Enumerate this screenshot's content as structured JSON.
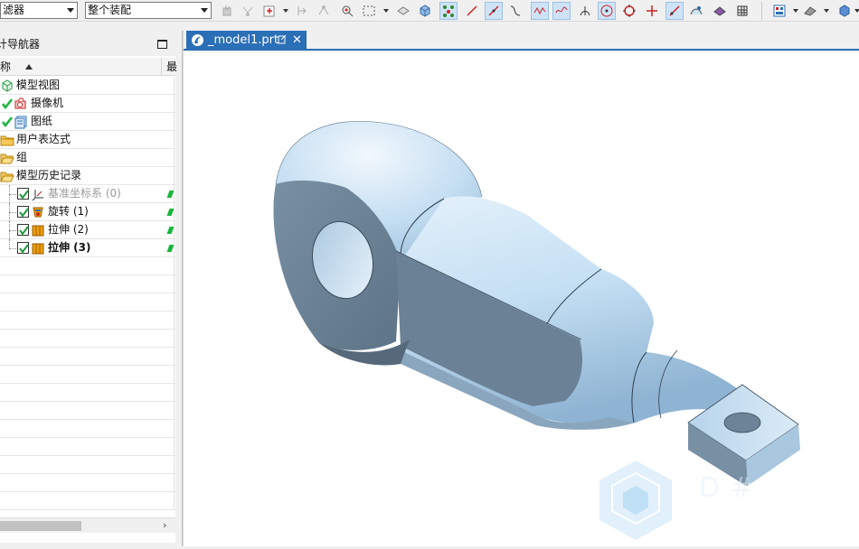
{
  "toolbar": {
    "filter_combo": "滤器",
    "scope_combo": "整个装配",
    "icons": [
      "snap-icon",
      "filter-point-icon",
      "select-point-icon",
      "move-icon",
      "move2-icon",
      "select-box-icon",
      "select-rect-icon",
      "show-hide-icon",
      "cube-shaded-icon",
      "vertex-icon",
      "curve-icon",
      "line-icon",
      "tangent-curve-icon",
      "spline-icon",
      "wave-icon",
      "intersection-icon",
      "center-icon",
      "circle-icon",
      "cross-icon",
      "slash-icon",
      "surface-icon",
      "face-icon",
      "grid-icon",
      "layout-icon",
      "render-icon",
      "cube-blue-icon"
    ]
  },
  "navigator": {
    "title": "计导航器",
    "column_name": "称",
    "column_second": "最"
  },
  "tree": {
    "items": [
      {
        "label": "模型视图"
      },
      {
        "label": "摄像机"
      },
      {
        "label": "图纸"
      },
      {
        "label": "用户表达式"
      },
      {
        "label": "组"
      },
      {
        "label": "模型历史记录"
      },
      {
        "label": "基准坐标系 (0)"
      },
      {
        "label": "旋转 (1)"
      },
      {
        "label": "拉伸 (2)"
      },
      {
        "label": "拉伸 (3)"
      }
    ]
  },
  "document": {
    "tab_label": "_model1.prt"
  },
  "colors": {
    "accent": "#2b6fb6",
    "part_light": "#c9e2f5",
    "part_dark": "#6e8598",
    "check_green": "#18b53a"
  }
}
